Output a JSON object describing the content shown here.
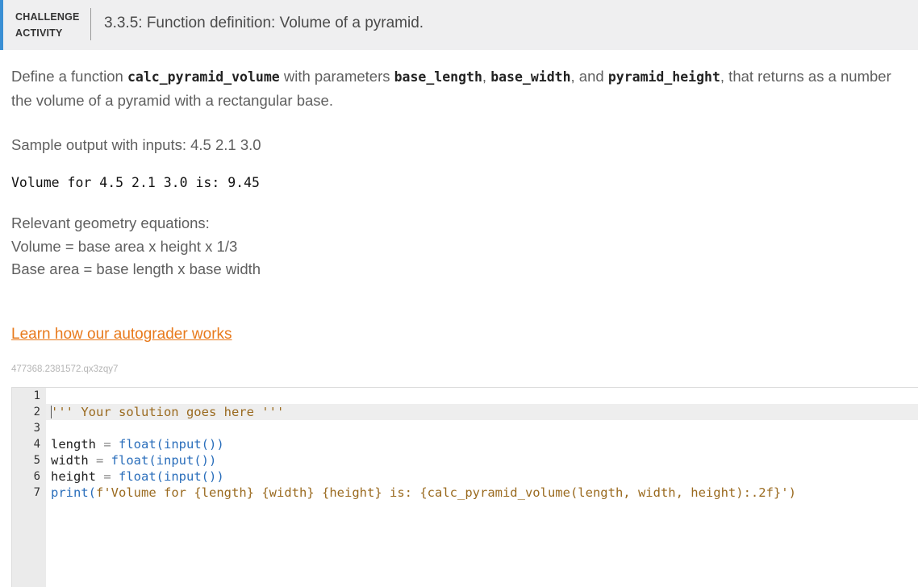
{
  "header": {
    "label_line1": "CHALLENGE",
    "label_line2": "ACTIVITY",
    "title": "3.3.5: Function definition: Volume of a pyramid.",
    "accent_color": "#3a8fd4"
  },
  "description": {
    "t1": "Define a function ",
    "c1": "calc_pyramid_volume",
    "t2": " with parameters ",
    "c2": "base_length",
    "t3": ", ",
    "c3": "base_width",
    "t4": ", and ",
    "c4": "pyramid_height",
    "t5": ", that returns as a number the volume of a pyramid with a rectangular base."
  },
  "sample": {
    "label": "Sample output with inputs: 4.5 2.1 3.0",
    "output": "Volume for 4.5 2.1 3.0 is: 9.45"
  },
  "geometry": {
    "heading": "Relevant geometry equations:",
    "eq1": "Volume = base area x height x 1/3",
    "eq2": "Base area = base length x base width"
  },
  "learn_link": "Learn how our autograder works",
  "activity_id": "477368.2381572.qx3zqy7",
  "editor": {
    "line_numbers": [
      "1",
      "2",
      "3",
      "4",
      "5",
      "6",
      "7"
    ],
    "line2": "''' Your solution goes here '''",
    "line4_var": "length",
    "line5_var": "width",
    "line6_var": "height",
    "eq": " = ",
    "float_input": "float(input())",
    "line7_print": "print(",
    "line7_fstr1": "f'Volume for ",
    "line7_b1": "{length}",
    "line7_sp": " ",
    "line7_b2": "{width}",
    "line7_b3": "{height}",
    "line7_is": " is: ",
    "line7_b4": "{calc_pyramid_volume(length, width, height):.2f}",
    "line7_end": "')"
  }
}
